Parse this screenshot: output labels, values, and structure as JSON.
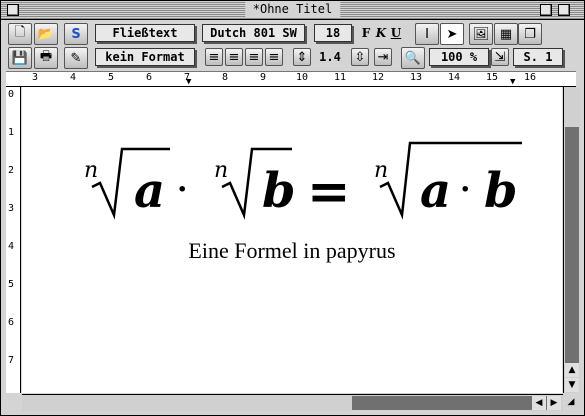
{
  "window": {
    "title": "*Ohne Titel"
  },
  "toolbar": {
    "paragraph_style": "Fließtext",
    "font_name": "Dutch 801 SW",
    "font_size": "18",
    "bold_label": "F",
    "italic_label": "K",
    "underline_label": "U",
    "char_format": "kein Format",
    "line_spacing": "1.4",
    "zoom": "100 %",
    "page": "S. 1"
  },
  "ruler": {
    "marks": [
      "3",
      "4",
      "5",
      "6",
      "7",
      "8",
      "9",
      "10",
      "11",
      "12",
      "13",
      "14",
      "15",
      "16"
    ],
    "vertical_marks": [
      "0",
      "1",
      "2",
      "3",
      "4",
      "5",
      "6",
      "7"
    ]
  },
  "document": {
    "formula_text": "ⁿ√a · ⁿ√b = ⁿ√(a · b)",
    "index": "n",
    "var_a": "a",
    "var_b": "b",
    "dot": "·",
    "equals": "=",
    "caption": "Eine Formel in papyrus"
  }
}
